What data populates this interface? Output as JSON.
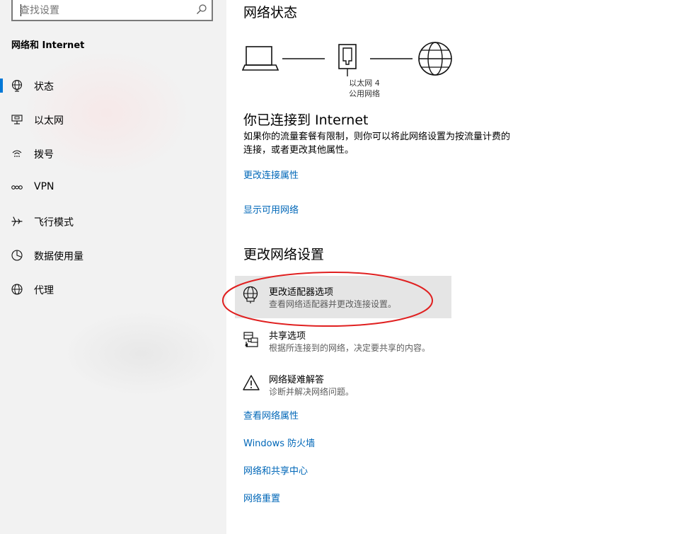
{
  "search": {
    "placeholder": "查找设置"
  },
  "sidebar": {
    "heading": "网络和 Internet",
    "items": [
      {
        "label": "状态",
        "icon": "globe-status-icon",
        "selected": true
      },
      {
        "label": "以太网",
        "icon": "ethernet-icon"
      },
      {
        "label": "拨号",
        "icon": "dialup-icon"
      },
      {
        "label": "VPN",
        "icon": "vpn-icon"
      },
      {
        "label": "飞行模式",
        "icon": "airplane-icon"
      },
      {
        "label": "数据使用量",
        "icon": "data-usage-icon"
      },
      {
        "label": "代理",
        "icon": "globe-proxy-icon"
      }
    ]
  },
  "main": {
    "title": "网络状态",
    "diagram": {
      "adapter_name": "以太网 4",
      "network_type": "公用网络"
    },
    "status_title": "你已连接到 Internet",
    "status_desc_line1": "如果你的流量套餐有限制，则你可以将此网络设置为按流量计费的",
    "status_desc_line2": "连接，或者更改其他属性。",
    "link_change_props": "更改连接属性",
    "link_show_networks": "显示可用网络",
    "section_title": "更改网络设置",
    "settings": [
      {
        "title": "更改适配器选项",
        "desc": "查看网络适配器并更改连接设置。",
        "icon": "adapter-globe-icon"
      },
      {
        "title": "共享选项",
        "desc": "根据所连接到的网络，决定要共享的内容。",
        "icon": "sharing-icon"
      },
      {
        "title": "网络疑难解答",
        "desc": "诊断并解决网络问题。",
        "icon": "warning-icon"
      }
    ],
    "links": [
      "查看网络属性",
      "Windows 防火墙",
      "网络和共享中心",
      "网络重置"
    ]
  },
  "colors": {
    "accent": "#0078d7",
    "link": "#0067b8",
    "annotation": "#e02020",
    "hover_bg": "#e5e5e5"
  }
}
